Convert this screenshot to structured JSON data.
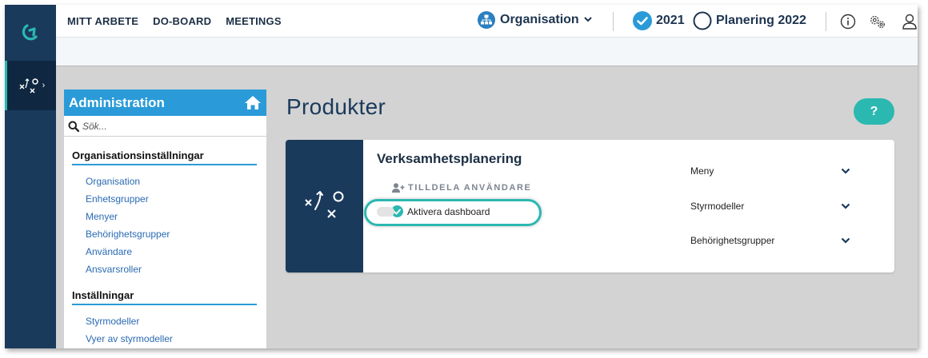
{
  "topnav": {
    "items": [
      "MITT ARBETE",
      "DO-BOARD",
      "MEETINGS"
    ],
    "organisation": "Organisation",
    "year_current": "2021",
    "year_planning": "Planering 2022"
  },
  "admin": {
    "title": "Administration",
    "search_placeholder": "Sök...",
    "sections": [
      {
        "title": "Organisationsinställningar",
        "links": [
          "Organisation",
          "Enhetsgrupper",
          "Menyer",
          "Behörighetsgrupper",
          "Användare",
          "Ansvarsroller"
        ]
      },
      {
        "title": "Inställningar",
        "links": [
          "Styrmodeller",
          "Vyer av styrmodeller"
        ]
      }
    ]
  },
  "main": {
    "page_title": "Produkter",
    "help_label": "?",
    "product": {
      "name": "Verksamhetsplanering",
      "assign_label": "TILLDELA ANVÄNDARE",
      "dashboard_label": "Aktivera dashboard",
      "dashboard_enabled": true,
      "dropdowns": [
        "Meny",
        "Styrmodeller",
        "Behörighetsgrupper"
      ]
    }
  },
  "colors": {
    "navy": "#1a3a5c",
    "teal": "#2bb8b0",
    "admin_blue": "#2a9bd8"
  }
}
